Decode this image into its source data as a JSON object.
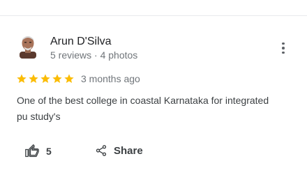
{
  "review": {
    "author": "Arun D'Silva",
    "meta": "5 reviews · 4 photos",
    "rating": 5,
    "date": "3 months ago",
    "text": "One of the best college in coastal Karnataka for integrated pu study's",
    "likes": "5",
    "share_label": "Share"
  },
  "colors": {
    "star": "#fbbc04",
    "muted": "#70757a",
    "text": "#3c4043"
  },
  "icons": {
    "avatar": "user-photo",
    "more": "more-vert-icon",
    "like": "thumb-up-icon",
    "share": "share-icon",
    "star": "star-icon"
  }
}
